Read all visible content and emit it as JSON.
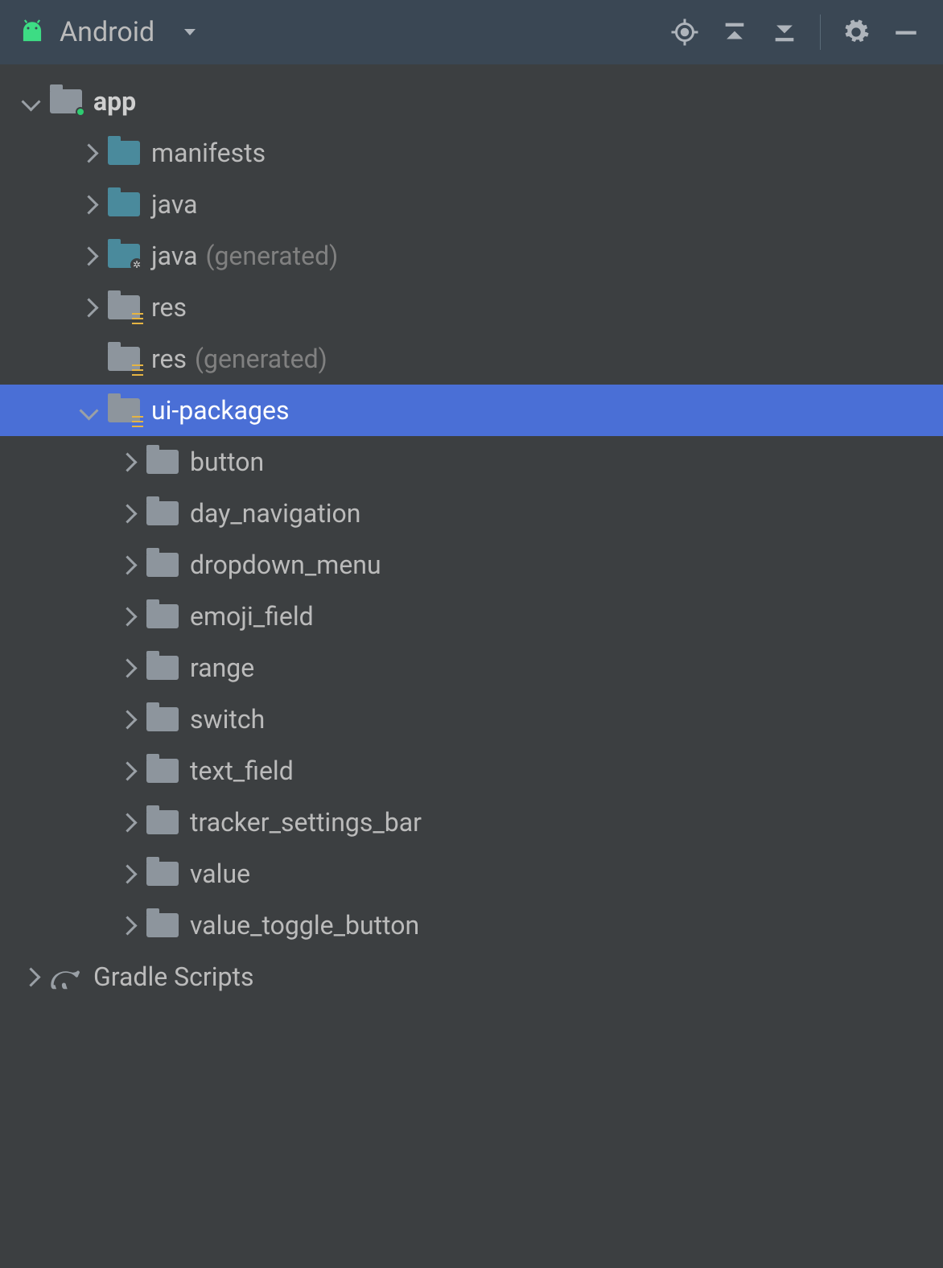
{
  "toolbar": {
    "title": "Android"
  },
  "tree": {
    "app": {
      "label": "app",
      "children": {
        "manifests": {
          "label": "manifests"
        },
        "java": {
          "label": "java"
        },
        "java_gen": {
          "label": "java",
          "suffix": "(generated)"
        },
        "res": {
          "label": "res"
        },
        "res_gen": {
          "label": "res",
          "suffix": "(generated)"
        },
        "ui_packages": {
          "label": "ui-packages",
          "children": {
            "button": "button",
            "day_navigation": "day_navigation",
            "dropdown_menu": "dropdown_menu",
            "emoji_field": "emoji_field",
            "range": "range",
            "switch": "switch",
            "text_field": "text_field",
            "tracker_settings_bar": "tracker_settings_bar",
            "value": "value",
            "value_toggle_button": "value_toggle_button"
          }
        }
      }
    },
    "gradle": {
      "label": "Gradle Scripts"
    }
  }
}
